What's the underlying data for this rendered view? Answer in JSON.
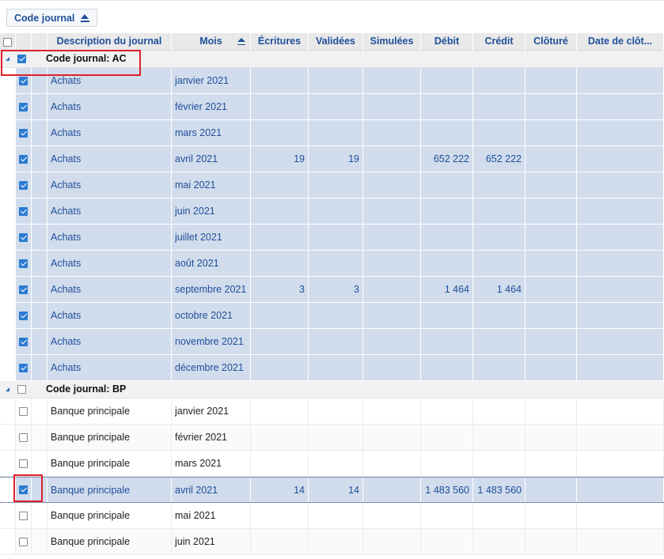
{
  "toolbar": {
    "group_chip_label": "Code journal"
  },
  "columns": {
    "description": "Description du journal",
    "mois": "Mois",
    "ecritures": "Écritures",
    "validees": "Validées",
    "simulees": "Simulées",
    "debit": "Débit",
    "credit": "Crédit",
    "cloture": "Clôturé",
    "date_cloture": "Date de clôt..."
  },
  "groups": [
    {
      "label": "Code journal: AC",
      "checked": true,
      "rows": [
        {
          "desc": "Achats",
          "mois": "janvier 2021",
          "ecritures": "",
          "validees": "",
          "simulees": "",
          "debit": "",
          "credit": "",
          "cloture": "",
          "date": "",
          "checked": true
        },
        {
          "desc": "Achats",
          "mois": "février 2021",
          "ecritures": "",
          "validees": "",
          "simulees": "",
          "debit": "",
          "credit": "",
          "cloture": "",
          "date": "",
          "checked": true
        },
        {
          "desc": "Achats",
          "mois": "mars 2021",
          "ecritures": "",
          "validees": "",
          "simulees": "",
          "debit": "",
          "credit": "",
          "cloture": "",
          "date": "",
          "checked": true
        },
        {
          "desc": "Achats",
          "mois": "avril 2021",
          "ecritures": "19",
          "validees": "19",
          "simulees": "",
          "debit": "652 222",
          "credit": "652 222",
          "cloture": "",
          "date": "",
          "checked": true
        },
        {
          "desc": "Achats",
          "mois": "mai 2021",
          "ecritures": "",
          "validees": "",
          "simulees": "",
          "debit": "",
          "credit": "",
          "cloture": "",
          "date": "",
          "checked": true
        },
        {
          "desc": "Achats",
          "mois": "juin 2021",
          "ecritures": "",
          "validees": "",
          "simulees": "",
          "debit": "",
          "credit": "",
          "cloture": "",
          "date": "",
          "checked": true
        },
        {
          "desc": "Achats",
          "mois": "juillet 2021",
          "ecritures": "",
          "validees": "",
          "simulees": "",
          "debit": "",
          "credit": "",
          "cloture": "",
          "date": "",
          "checked": true
        },
        {
          "desc": "Achats",
          "mois": "août 2021",
          "ecritures": "",
          "validees": "",
          "simulees": "",
          "debit": "",
          "credit": "",
          "cloture": "",
          "date": "",
          "checked": true
        },
        {
          "desc": "Achats",
          "mois": "septembre 2021",
          "ecritures": "3",
          "validees": "3",
          "simulees": "",
          "debit": "1 464",
          "credit": "1 464",
          "cloture": "",
          "date": "",
          "checked": true
        },
        {
          "desc": "Achats",
          "mois": "octobre 2021",
          "ecritures": "",
          "validees": "",
          "simulees": "",
          "debit": "",
          "credit": "",
          "cloture": "",
          "date": "",
          "checked": true
        },
        {
          "desc": "Achats",
          "mois": "novembre 2021",
          "ecritures": "",
          "validees": "",
          "simulees": "",
          "debit": "",
          "credit": "",
          "cloture": "",
          "date": "",
          "checked": true
        },
        {
          "desc": "Achats",
          "mois": "décembre 2021",
          "ecritures": "",
          "validees": "",
          "simulees": "",
          "debit": "",
          "credit": "",
          "cloture": "",
          "date": "",
          "checked": true
        }
      ]
    },
    {
      "label": "Code journal: BP",
      "checked": false,
      "rows": [
        {
          "desc": "Banque principale",
          "mois": "janvier 2021",
          "ecritures": "",
          "validees": "",
          "simulees": "",
          "debit": "",
          "credit": "",
          "cloture": "",
          "date": "",
          "checked": false
        },
        {
          "desc": "Banque principale",
          "mois": "février 2021",
          "ecritures": "",
          "validees": "",
          "simulees": "",
          "debit": "",
          "credit": "",
          "cloture": "",
          "date": "",
          "checked": false
        },
        {
          "desc": "Banque principale",
          "mois": "mars 2021",
          "ecritures": "",
          "validees": "",
          "simulees": "",
          "debit": "",
          "credit": "",
          "cloture": "",
          "date": "",
          "checked": false
        },
        {
          "desc": "Banque principale",
          "mois": "avril 2021",
          "ecritures": "14",
          "validees": "14",
          "simulees": "",
          "debit": "1 483 560",
          "credit": "1 483 560",
          "cloture": "",
          "date": "",
          "checked": true,
          "focused": true
        },
        {
          "desc": "Banque principale",
          "mois": "mai 2021",
          "ecritures": "",
          "validees": "",
          "simulees": "",
          "debit": "",
          "credit": "",
          "cloture": "",
          "date": "",
          "checked": false
        },
        {
          "desc": "Banque principale",
          "mois": "juin 2021",
          "ecritures": "",
          "validees": "",
          "simulees": "",
          "debit": "",
          "credit": "",
          "cloture": "",
          "date": "",
          "checked": false
        }
      ]
    }
  ],
  "colors": {
    "selected_row": "#d1dcec",
    "accent": "#1f4f9a",
    "highlight": "#e0202a",
    "checkbox_on": "#2b7bd1"
  }
}
